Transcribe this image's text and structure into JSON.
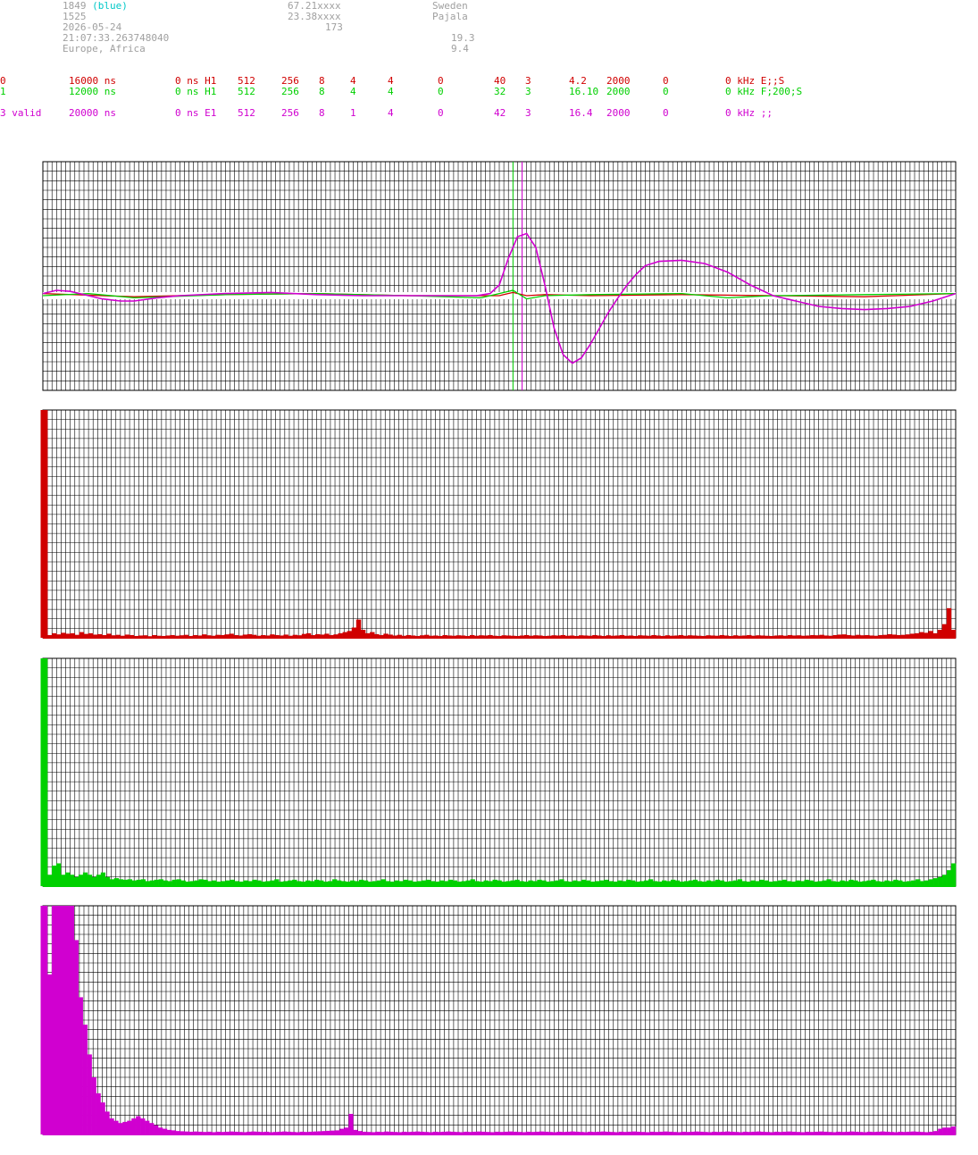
{
  "header": {
    "station_id": "1849",
    "station_tag": "(blue)",
    "line2_left": "1525",
    "date": "2026-05-24",
    "time": "21:07:33.263748040",
    "region": "Europe, Africa",
    "lat": "67.21xxxx",
    "lon": "23.38xxxx",
    "elev": "173",
    "country": "Sweden",
    "city": "Pajala",
    "val1": "19.3",
    "val2": "9.4"
  },
  "channel_rows": [
    {
      "color": "#d00000",
      "cells": [
        "0",
        "16000 ns",
        "0 ns H1",
        "512",
        "256",
        "8",
        "4",
        "4",
        "0",
        "40",
        "3",
        "4.2",
        "2000",
        "0",
        "0 kHz E;;S"
      ]
    },
    {
      "color": "#00d000",
      "cells": [
        "1",
        "12000 ns",
        "0 ns H1",
        "512",
        "256",
        "8",
        "4",
        "4",
        "0",
        "32",
        "3",
        "16.10",
        "2000",
        "0",
        "0 kHz F;200;S"
      ]
    },
    {
      "color": "#d000d0",
      "cells": [
        "3 valid",
        "20000 ns",
        "0 ns E1",
        "512",
        "256",
        "8",
        "1",
        "4",
        "0",
        "42",
        "3",
        "16.4",
        "2000",
        "0",
        "0 kHz ;;"
      ]
    }
  ],
  "chart_data": [
    {
      "type": "line",
      "title": "",
      "grid": true,
      "ylim": [
        -1,
        1
      ],
      "xlim": [
        0,
        200
      ],
      "series": [
        {
          "color": "#d00000",
          "x": [
            0,
            20,
            40,
            60,
            80,
            100,
            101,
            103,
            106,
            110,
            120,
            140,
            160,
            180,
            200
          ],
          "y": [
            0.02,
            -0.01,
            0.01,
            0.02,
            0.0,
            0.0,
            0.01,
            0.03,
            0.0,
            0.01,
            0.0,
            0.01,
            0.0,
            -0.01,
            0.02
          ]
        },
        {
          "color": "#00d000",
          "x": [
            0,
            10,
            20,
            40,
            60,
            80,
            96,
            100,
            103,
            106,
            110,
            120,
            140,
            150,
            160,
            180,
            200
          ],
          "y": [
            0.0,
            0.02,
            -0.02,
            0.01,
            0.02,
            0.0,
            -0.02,
            0.02,
            0.05,
            -0.03,
            0.0,
            0.01,
            0.02,
            -0.02,
            0.0,
            0.01,
            0.02
          ]
        },
        {
          "color": "#d000d0",
          "x": [
            0,
            3,
            6,
            10,
            13,
            17,
            20,
            25,
            30,
            40,
            50,
            60,
            70,
            80,
            90,
            95,
            98,
            100,
            102,
            104,
            106,
            108,
            110,
            112,
            114,
            116,
            118,
            120,
            122,
            124,
            126,
            128,
            130,
            132,
            135,
            140,
            145,
            150,
            155,
            160,
            165,
            170,
            175,
            180,
            185,
            190,
            195,
            200
          ],
          "y": [
            0.02,
            0.05,
            0.04,
            0.0,
            -0.03,
            -0.05,
            -0.05,
            -0.02,
            0.0,
            0.02,
            0.03,
            0.01,
            0.0,
            0.0,
            0.0,
            0.0,
            0.02,
            0.1,
            0.35,
            0.55,
            0.58,
            0.45,
            0.1,
            -0.3,
            -0.55,
            -0.63,
            -0.58,
            -0.45,
            -0.3,
            -0.15,
            -0.02,
            0.1,
            0.2,
            0.28,
            0.32,
            0.33,
            0.3,
            0.22,
            0.1,
            0.0,
            -0.05,
            -0.1,
            -0.12,
            -0.13,
            -0.12,
            -0.1,
            -0.05,
            0.02
          ]
        }
      ],
      "markers": [
        {
          "color": "#00d000",
          "x": 103
        },
        {
          "color": "#d000d0",
          "x": 105
        }
      ]
    },
    {
      "type": "bar",
      "color": "#d00000",
      "ylim": [
        0,
        1
      ],
      "values": [
        1.0,
        0.012,
        0.02,
        0.015,
        0.022,
        0.018,
        0.02,
        0.013,
        0.025,
        0.017,
        0.02,
        0.014,
        0.016,
        0.012,
        0.018,
        0.011,
        0.013,
        0.009,
        0.014,
        0.012,
        0.008,
        0.01,
        0.011,
        0.007,
        0.012,
        0.009,
        0.008,
        0.01,
        0.012,
        0.009,
        0.011,
        0.013,
        0.008,
        0.012,
        0.01,
        0.015,
        0.011,
        0.009,
        0.013,
        0.012,
        0.015,
        0.018,
        0.012,
        0.01,
        0.014,
        0.016,
        0.013,
        0.009,
        0.012,
        0.01,
        0.015,
        0.012,
        0.01,
        0.014,
        0.009,
        0.013,
        0.011,
        0.017,
        0.02,
        0.012,
        0.016,
        0.014,
        0.018,
        0.012,
        0.015,
        0.02,
        0.025,
        0.03,
        0.045,
        0.08,
        0.035,
        0.02,
        0.025,
        0.016,
        0.012,
        0.018,
        0.014,
        0.01,
        0.013,
        0.009,
        0.012,
        0.01,
        0.008,
        0.011,
        0.013,
        0.009,
        0.01,
        0.008,
        0.012,
        0.01,
        0.009,
        0.011,
        0.01,
        0.008,
        0.012,
        0.009,
        0.011,
        0.01,
        0.012,
        0.009,
        0.008,
        0.011,
        0.01,
        0.009,
        0.008,
        0.01,
        0.012,
        0.009,
        0.011,
        0.01,
        0.008,
        0.009,
        0.011,
        0.01,
        0.012,
        0.009,
        0.01,
        0.008,
        0.011,
        0.01,
        0.009,
        0.012,
        0.01,
        0.008,
        0.011,
        0.009,
        0.01,
        0.012,
        0.009,
        0.01,
        0.008,
        0.011,
        0.01,
        0.009,
        0.012,
        0.01,
        0.008,
        0.011,
        0.009,
        0.01,
        0.012,
        0.009,
        0.011,
        0.01,
        0.009,
        0.008,
        0.011,
        0.01,
        0.009,
        0.012,
        0.01,
        0.008,
        0.011,
        0.009,
        0.01,
        0.012,
        0.009,
        0.011,
        0.01,
        0.009,
        0.008,
        0.01,
        0.011,
        0.009,
        0.012,
        0.01,
        0.011,
        0.009,
        0.01,
        0.012,
        0.011,
        0.013,
        0.01,
        0.009,
        0.012,
        0.014,
        0.015,
        0.012,
        0.01,
        0.013,
        0.011,
        0.012,
        0.01,
        0.009,
        0.012,
        0.013,
        0.016,
        0.014,
        0.012,
        0.013,
        0.015,
        0.018,
        0.02,
        0.025,
        0.022,
        0.03,
        0.02,
        0.035,
        0.06,
        0.13,
        0.035
      ]
    },
    {
      "type": "bar",
      "color": "#00d000",
      "ylim": [
        0,
        1
      ],
      "values": [
        1.0,
        0.05,
        0.09,
        0.1,
        0.05,
        0.06,
        0.05,
        0.04,
        0.05,
        0.06,
        0.05,
        0.04,
        0.05,
        0.06,
        0.04,
        0.03,
        0.035,
        0.03,
        0.028,
        0.03,
        0.025,
        0.028,
        0.03,
        0.022,
        0.025,
        0.028,
        0.03,
        0.025,
        0.022,
        0.028,
        0.03,
        0.025,
        0.02,
        0.022,
        0.025,
        0.03,
        0.028,
        0.022,
        0.025,
        0.02,
        0.022,
        0.025,
        0.028,
        0.022,
        0.02,
        0.025,
        0.022,
        0.028,
        0.025,
        0.02,
        0.022,
        0.025,
        0.03,
        0.02,
        0.022,
        0.025,
        0.028,
        0.022,
        0.02,
        0.025,
        0.022,
        0.028,
        0.025,
        0.02,
        0.022,
        0.03,
        0.025,
        0.022,
        0.02,
        0.025,
        0.022,
        0.028,
        0.025,
        0.02,
        0.022,
        0.025,
        0.03,
        0.022,
        0.02,
        0.025,
        0.022,
        0.028,
        0.025,
        0.02,
        0.022,
        0.025,
        0.028,
        0.022,
        0.02,
        0.025,
        0.022,
        0.028,
        0.025,
        0.02,
        0.022,
        0.025,
        0.03,
        0.022,
        0.02,
        0.025,
        0.022,
        0.028,
        0.025,
        0.02,
        0.022,
        0.025,
        0.028,
        0.022,
        0.02,
        0.025,
        0.022,
        0.028,
        0.025,
        0.02,
        0.022,
        0.025,
        0.03,
        0.022,
        0.02,
        0.025,
        0.022,
        0.028,
        0.025,
        0.02,
        0.022,
        0.025,
        0.028,
        0.022,
        0.02,
        0.025,
        0.022,
        0.028,
        0.025,
        0.02,
        0.022,
        0.025,
        0.03,
        0.022,
        0.02,
        0.025,
        0.022,
        0.028,
        0.025,
        0.02,
        0.022,
        0.025,
        0.028,
        0.022,
        0.02,
        0.025,
        0.022,
        0.028,
        0.025,
        0.02,
        0.022,
        0.025,
        0.03,
        0.022,
        0.02,
        0.025,
        0.022,
        0.028,
        0.025,
        0.02,
        0.022,
        0.025,
        0.028,
        0.022,
        0.02,
        0.025,
        0.022,
        0.028,
        0.025,
        0.02,
        0.022,
        0.025,
        0.03,
        0.022,
        0.02,
        0.025,
        0.022,
        0.028,
        0.025,
        0.02,
        0.022,
        0.025,
        0.028,
        0.022,
        0.02,
        0.025,
        0.022,
        0.028,
        0.025,
        0.02,
        0.022,
        0.025,
        0.03,
        0.022,
        0.025,
        0.03,
        0.035,
        0.04,
        0.05,
        0.07,
        0.1
      ]
    },
    {
      "type": "bar",
      "color": "#d000d0",
      "ylim": [
        0,
        1
      ],
      "values": [
        1.0,
        0.7,
        1.0,
        1.0,
        1.0,
        1.0,
        1.0,
        0.85,
        0.6,
        0.48,
        0.35,
        0.25,
        0.18,
        0.14,
        0.1,
        0.07,
        0.06,
        0.05,
        0.055,
        0.06,
        0.07,
        0.08,
        0.07,
        0.06,
        0.05,
        0.04,
        0.03,
        0.025,
        0.02,
        0.018,
        0.015,
        0.014,
        0.013,
        0.012,
        0.013,
        0.012,
        0.011,
        0.012,
        0.01,
        0.012,
        0.011,
        0.012,
        0.013,
        0.012,
        0.011,
        0.01,
        0.012,
        0.013,
        0.012,
        0.011,
        0.012,
        0.01,
        0.011,
        0.012,
        0.013,
        0.012,
        0.011,
        0.01,
        0.012,
        0.011,
        0.012,
        0.013,
        0.014,
        0.015,
        0.016,
        0.017,
        0.018,
        0.025,
        0.03,
        0.09,
        0.02,
        0.015,
        0.012,
        0.011,
        0.01,
        0.012,
        0.011,
        0.013,
        0.012,
        0.011,
        0.01,
        0.012,
        0.011,
        0.012,
        0.013,
        0.012,
        0.011,
        0.01,
        0.012,
        0.011,
        0.012,
        0.013,
        0.012,
        0.011,
        0.01,
        0.012,
        0.011,
        0.012,
        0.013,
        0.012,
        0.011,
        0.01,
        0.012,
        0.011,
        0.012,
        0.013,
        0.012,
        0.011,
        0.01,
        0.012,
        0.011,
        0.012,
        0.013,
        0.012,
        0.011,
        0.01,
        0.012,
        0.011,
        0.012,
        0.013,
        0.012,
        0.011,
        0.01,
        0.012,
        0.011,
        0.012,
        0.013,
        0.012,
        0.011,
        0.01,
        0.012,
        0.011,
        0.012,
        0.013,
        0.012,
        0.011,
        0.01,
        0.012,
        0.011,
        0.012,
        0.013,
        0.012,
        0.011,
        0.01,
        0.012,
        0.011,
        0.012,
        0.013,
        0.012,
        0.011,
        0.01,
        0.012,
        0.011,
        0.012,
        0.013,
        0.012,
        0.011,
        0.01,
        0.012,
        0.011,
        0.012,
        0.013,
        0.012,
        0.011,
        0.01,
        0.012,
        0.011,
        0.012,
        0.013,
        0.012,
        0.011,
        0.01,
        0.012,
        0.011,
        0.012,
        0.013,
        0.012,
        0.011,
        0.01,
        0.012,
        0.011,
        0.012,
        0.013,
        0.012,
        0.011,
        0.01,
        0.012,
        0.011,
        0.012,
        0.013,
        0.012,
        0.011,
        0.01,
        0.012,
        0.011,
        0.012,
        0.013,
        0.012,
        0.011,
        0.01,
        0.012,
        0.015,
        0.025,
        0.03,
        0.03,
        0.035
      ]
    }
  ]
}
